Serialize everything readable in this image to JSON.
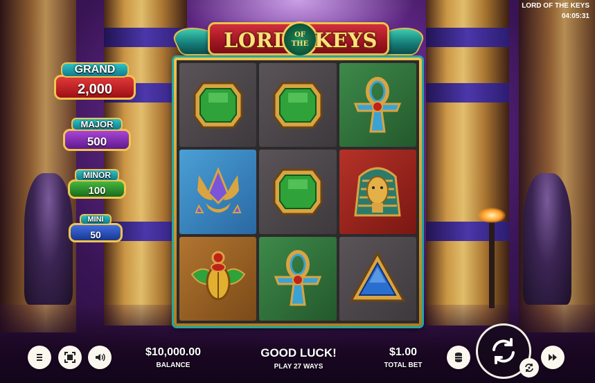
{
  "title": {
    "word1": "LORD",
    "word2_top": "OF",
    "word2_bottom": "THE",
    "word3": "KEYS"
  },
  "info": {
    "game_name": "LORD OF THE KEYS",
    "clock": "04:05:31"
  },
  "jackpots": [
    {
      "label": "GRAND",
      "value": "2,000",
      "color": "#c8202a"
    },
    {
      "label": "MAJOR",
      "value": "500",
      "color": "#7a2aa8"
    },
    {
      "label": "MINOR",
      "value": "100",
      "color": "#2f8a2c"
    },
    {
      "label": "MINI",
      "value": "50",
      "color": "#2d52b8"
    }
  ],
  "reels": [
    [
      "green-gem",
      "green-gem",
      "ankh"
    ],
    [
      "lotus",
      "green-gem",
      "pharaoh"
    ],
    [
      "scarab",
      "ankh",
      "blue-triangle-gem"
    ]
  ],
  "bottom": {
    "balance_value": "$10,000.00",
    "balance_label": "BALANCE",
    "status_text": "GOOD LUCK!",
    "ways_text": "PLAY 27 WAYS",
    "bet_value": "$1.00",
    "bet_label": "TOTAL BET"
  },
  "colors": {
    "gold": "#f2c44f",
    "teal": "#21a8a0",
    "background": "#3a1557"
  }
}
